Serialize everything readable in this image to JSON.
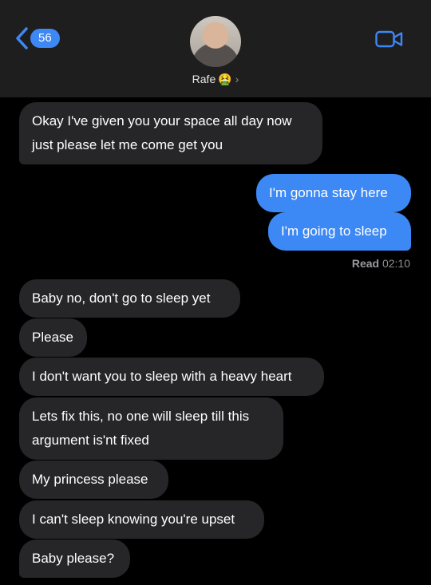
{
  "header": {
    "back_count": "56",
    "contact_name": "Rafe",
    "contact_emoji": "🤮",
    "chevron": "›"
  },
  "messages": [
    {
      "side": "in",
      "lines": [
        "Okay I've given you your space all day now",
        "just please let me come get you"
      ]
    },
    {
      "side": "out",
      "lines": [
        "I'm gonna stay here"
      ]
    },
    {
      "side": "out",
      "lines": [
        "I'm going to sleep"
      ]
    },
    {
      "side": "in",
      "lines": [
        "Baby no, don't go to sleep yet"
      ]
    },
    {
      "side": "in",
      "lines": [
        "Please"
      ]
    },
    {
      "side": "in",
      "lines": [
        "I don't want you to sleep with a heavy heart"
      ]
    },
    {
      "side": "in",
      "lines": [
        "Lets fix this, no one will sleep till this",
        "argument is'nt fixed"
      ]
    },
    {
      "side": "in",
      "lines": [
        "My princess please"
      ]
    },
    {
      "side": "in",
      "lines": [
        "I can't sleep knowing you're upset"
      ]
    },
    {
      "side": "in",
      "lines": [
        "Baby please?"
      ]
    }
  ],
  "receipt": {
    "label": "Read",
    "time": "02:10"
  },
  "colors": {
    "outgoing": "#3c88f5",
    "incoming": "#262628",
    "badge": "#3d88f5",
    "header": "#1e1e1e"
  },
  "icons": {
    "back": "chevron-left-icon",
    "video": "video-camera-icon"
  }
}
